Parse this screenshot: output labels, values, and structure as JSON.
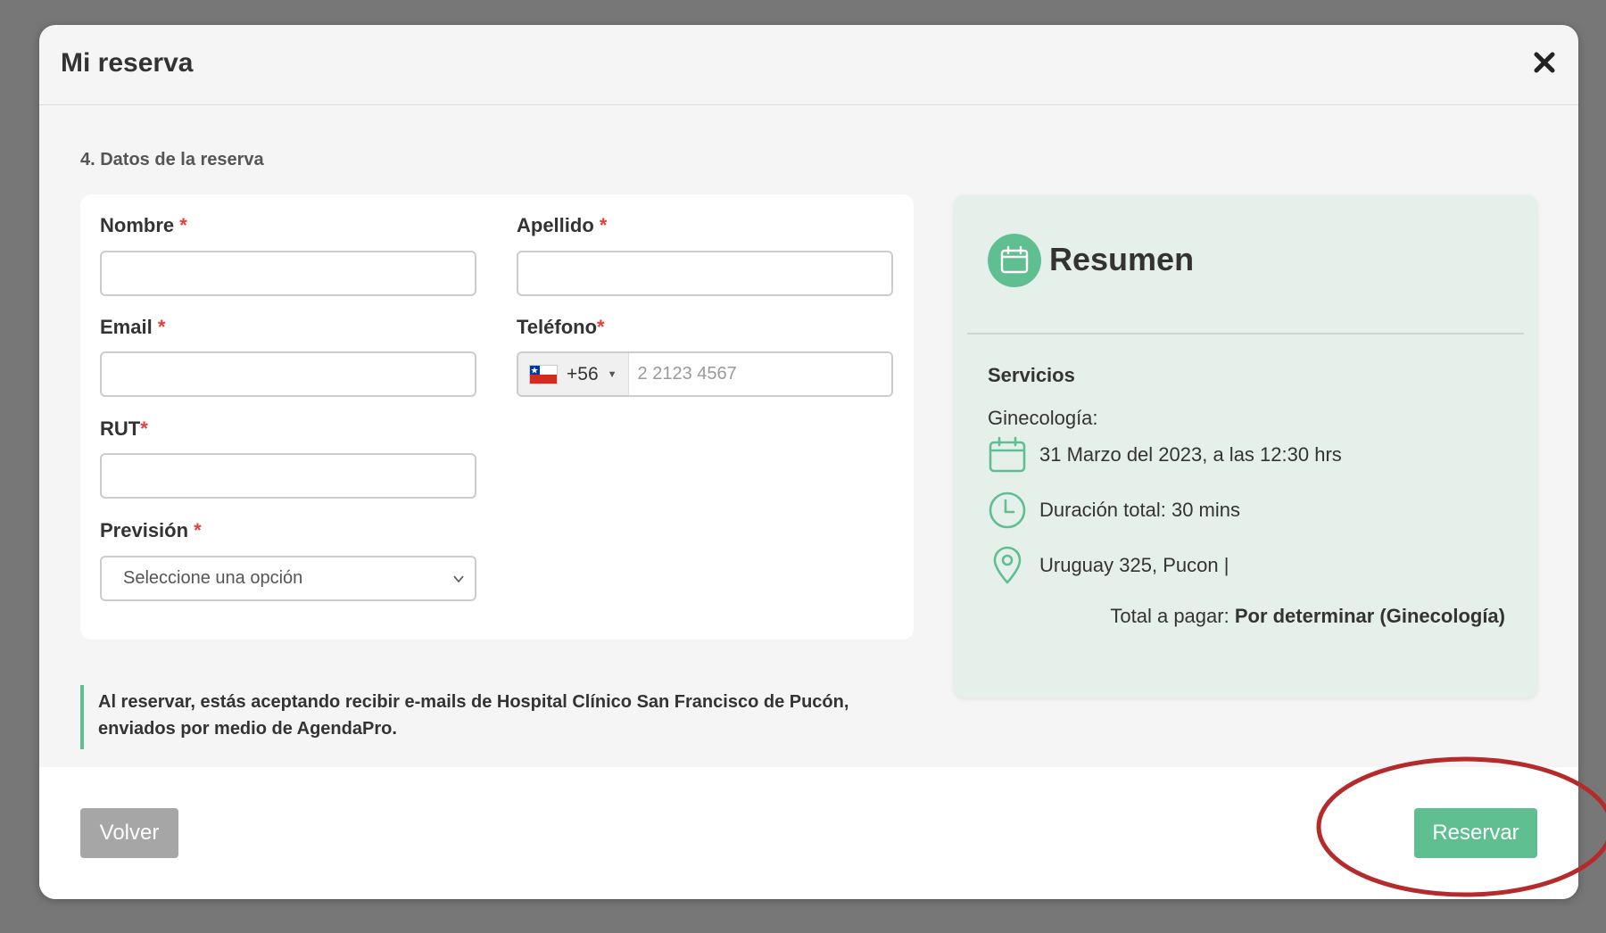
{
  "modal": {
    "title": "Mi reserva"
  },
  "step": {
    "title": "4. Datos de la reserva"
  },
  "form": {
    "nombre": {
      "label": "Nombre",
      "required": "*",
      "value": ""
    },
    "apellido": {
      "label": "Apellido",
      "required": "*",
      "value": ""
    },
    "email": {
      "label": "Email",
      "required": "*",
      "value": ""
    },
    "telefono": {
      "label": "Teléfono",
      "required": "*",
      "dial_code": "+56",
      "placeholder": "2 2123 4567",
      "flag_icon": "chile-flag-icon"
    },
    "rut": {
      "label": "RUT",
      "required": "*",
      "value": ""
    },
    "prevision": {
      "label": "Previsión",
      "required": "*",
      "selected": "Seleccione una opción"
    }
  },
  "notice": {
    "line1": "Al reservar, estás aceptando recibir e-mails de Hospital Clínico San Francisco de Pucón,",
    "line2": "enviados por medio de AgendaPro."
  },
  "summary": {
    "title": "Resumen",
    "services_label": "Servicios",
    "service_name": "Ginecología:",
    "date": "31 Marzo del 2023, a las 12:30 hrs",
    "duration": "Duración total: 30 mins",
    "location": "Uruguay 325, Pucon |",
    "total_label": "Total a pagar:",
    "total_value": "Por determinar (Ginecología)"
  },
  "footer": {
    "back_label": "Volver",
    "reserve_label": "Reservar"
  },
  "colors": {
    "accent": "#5fbf90",
    "required": "#e0413b",
    "annotation": "#b52a2a",
    "overlay": "#777777"
  }
}
